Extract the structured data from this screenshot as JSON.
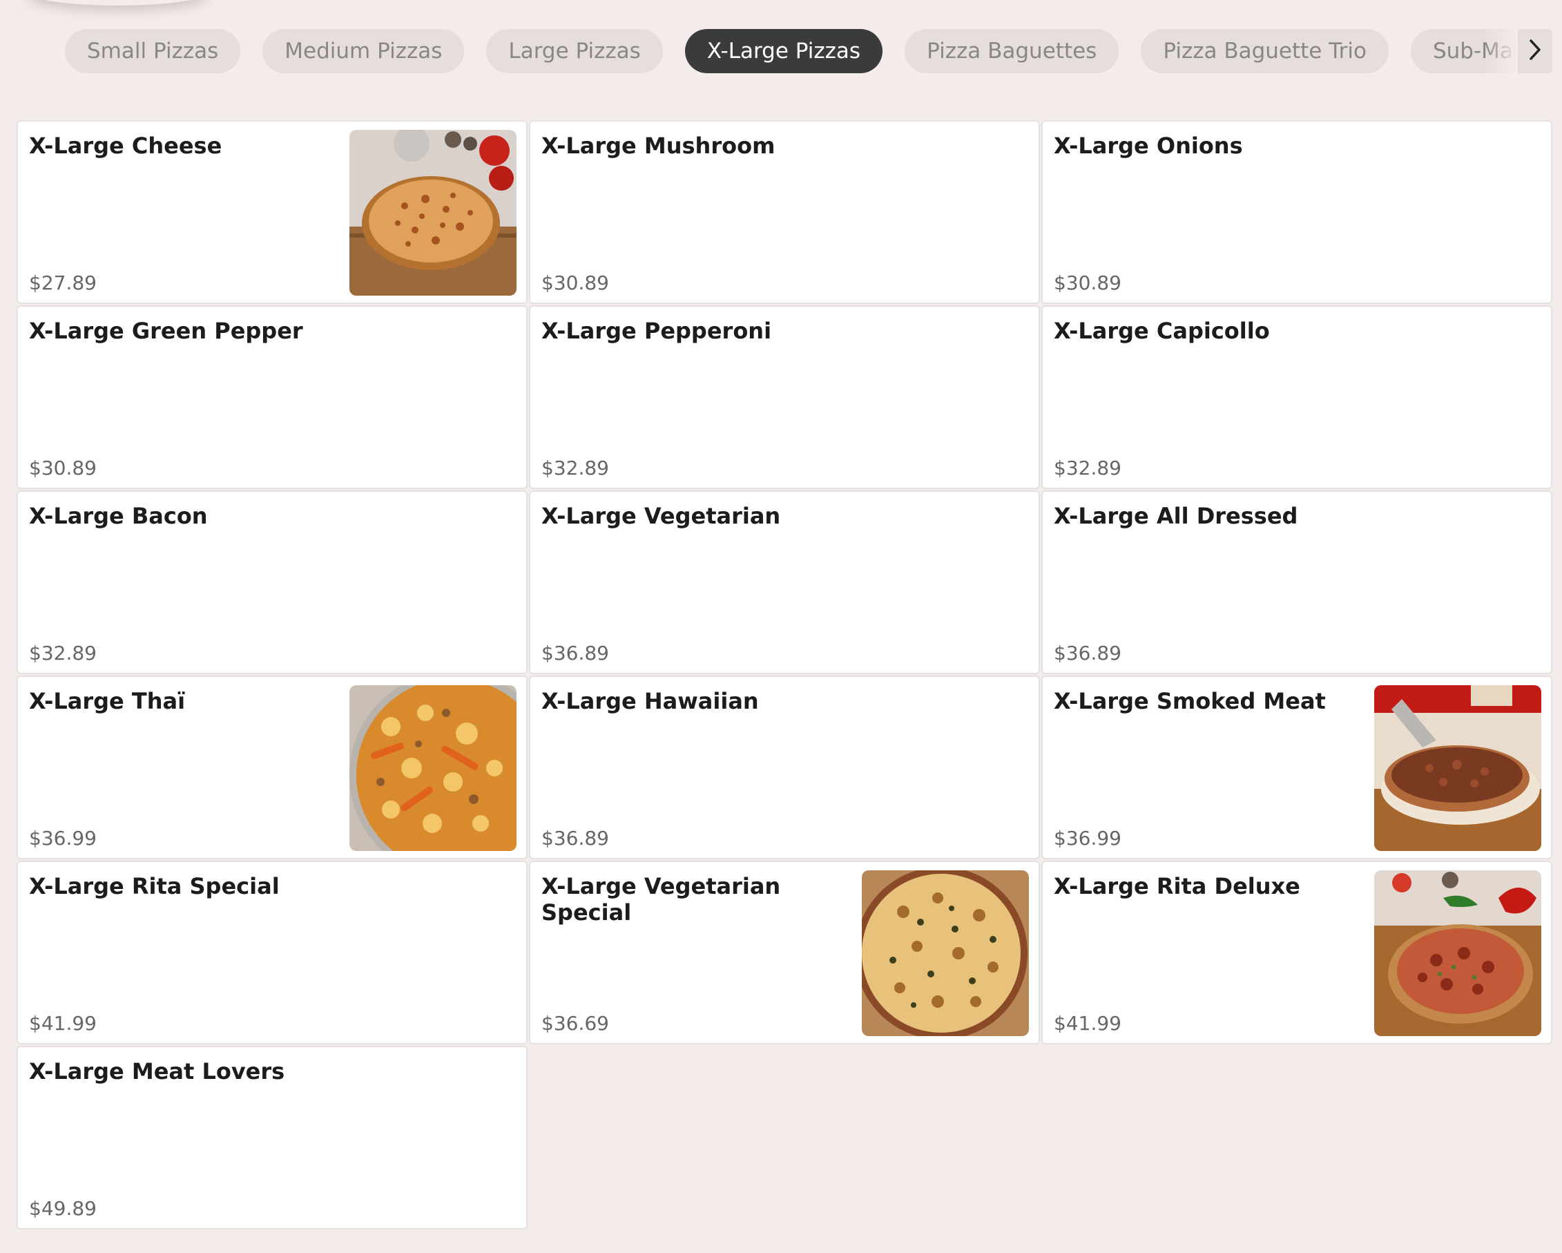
{
  "categories": [
    {
      "label": "Small Pizzas",
      "active": false
    },
    {
      "label": "Medium Pizzas",
      "active": false
    },
    {
      "label": "Large Pizzas",
      "active": false
    },
    {
      "label": "X-Large Pizzas",
      "active": true
    },
    {
      "label": "Pizza Baguettes",
      "active": false
    },
    {
      "label": "Pizza Baguette Trio",
      "active": false
    },
    {
      "label": "Sub-Marin",
      "active": false
    }
  ],
  "scroll_icon": "chevron-right-icon",
  "items": [
    {
      "name": "X-Large Cheese",
      "price": "$27.89",
      "image": "cheese-pizza-photo"
    },
    {
      "name": "X-Large Mushroom",
      "price": "$30.89"
    },
    {
      "name": "X-Large Onions",
      "price": "$30.89"
    },
    {
      "name": "X-Large Green Pepper",
      "price": "$30.89"
    },
    {
      "name": "X-Large Pepperoni",
      "price": "$32.89"
    },
    {
      "name": "X-Large Capicollo",
      "price": "$32.89"
    },
    {
      "name": "X-Large Bacon",
      "price": "$32.89"
    },
    {
      "name": "X-Large Vegetarian",
      "price": "$36.89"
    },
    {
      "name": "X-Large All Dressed",
      "price": "$36.89"
    },
    {
      "name": "X-Large Thaï",
      "price": "$36.99",
      "image": "thai-pizza-photo"
    },
    {
      "name": "X-Large Hawaiian",
      "price": "$36.89"
    },
    {
      "name": "X-Large Smoked Meat",
      "price": "$36.99",
      "image": "smoked-meat-pizza-photo"
    },
    {
      "name": "X-Large Rita Special",
      "price": "$41.99"
    },
    {
      "name": "X-Large Vegetarian Special",
      "price": "$36.69",
      "image": "vegetarian-special-pizza-photo"
    },
    {
      "name": "X-Large Rita Deluxe",
      "price": "$41.99",
      "image": "rita-deluxe-pizza-photo"
    },
    {
      "name": "X-Large Meat Lovers",
      "price": "$49.89"
    }
  ],
  "colors": {
    "active_tab": "#3b3b3b",
    "tab": "#e6dedc",
    "page_bg": "#f4ecea"
  }
}
